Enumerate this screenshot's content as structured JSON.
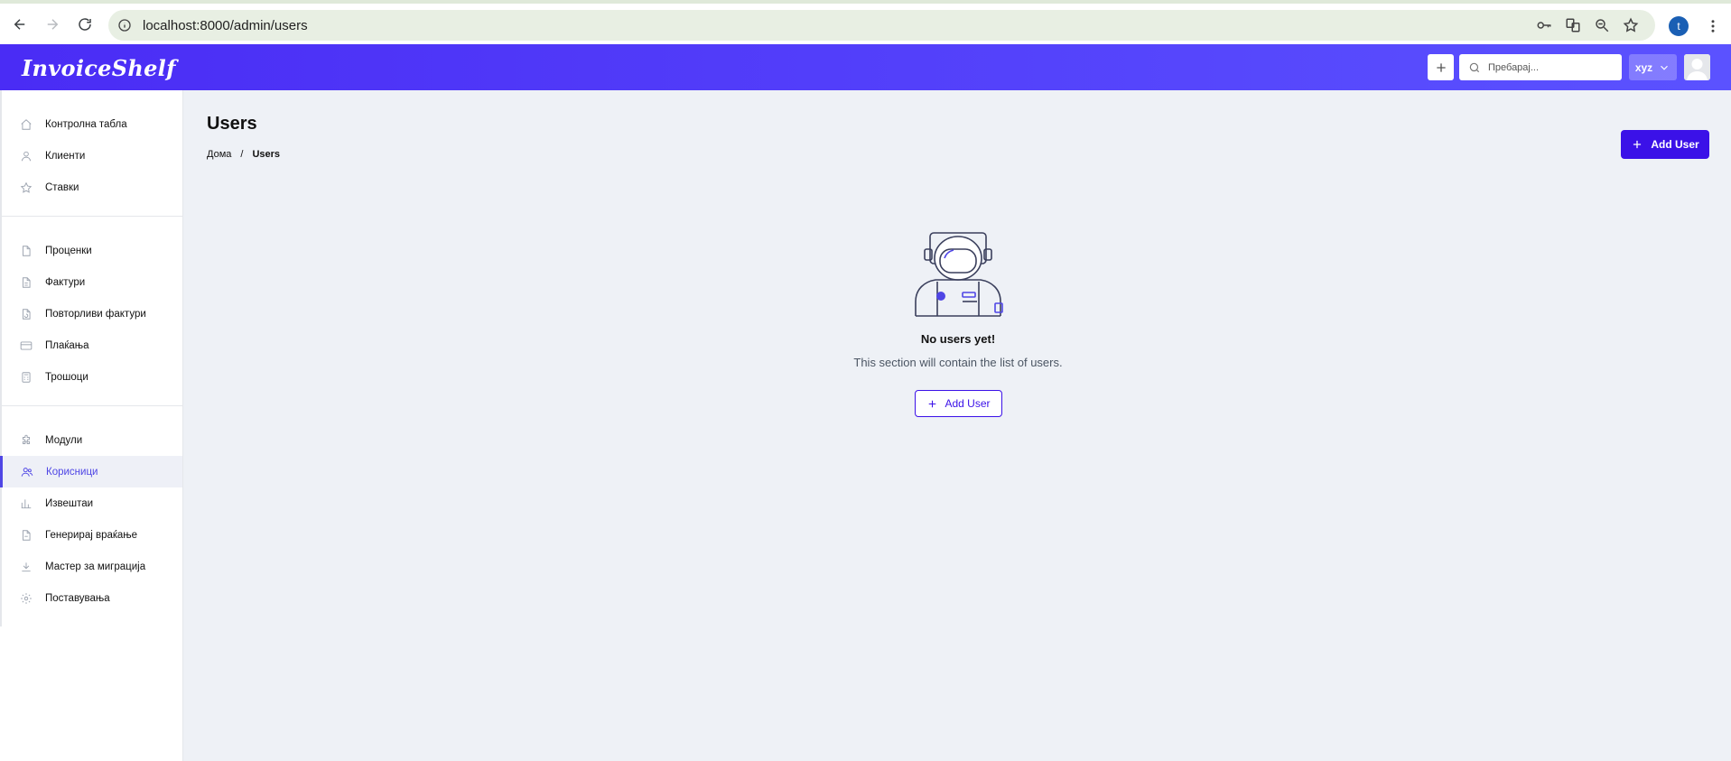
{
  "browser": {
    "url": "localhost:8000/admin/users",
    "profile_initial": "t"
  },
  "header": {
    "logo": "InvoiceShelf",
    "search_placeholder": "Пребарај...",
    "company": "xyz"
  },
  "sidebar": {
    "groups": [
      [
        {
          "label": "Контролна табла",
          "icon": "home-icon"
        },
        {
          "label": "Клиенти",
          "icon": "user-icon"
        },
        {
          "label": "Ставки",
          "icon": "star-icon"
        }
      ],
      [
        {
          "label": "Проценки",
          "icon": "document-icon"
        },
        {
          "label": "Фактури",
          "icon": "document-text-icon"
        },
        {
          "label": "Повторливи фактури",
          "icon": "document-repeat-icon"
        },
        {
          "label": "Плаќања",
          "icon": "credit-card-icon"
        },
        {
          "label": "Трошоци",
          "icon": "calculator-icon"
        }
      ],
      [
        {
          "label": "Модули",
          "icon": "puzzle-icon"
        },
        {
          "label": "Корисници",
          "icon": "users-icon",
          "active": true
        },
        {
          "label": "Извештаи",
          "icon": "chart-bar-icon"
        },
        {
          "label": "Генерирај враќање",
          "icon": "document-return-icon"
        },
        {
          "label": "Мастер за миграција",
          "icon": "download-icon"
        },
        {
          "label": "Поставувања",
          "icon": "cog-icon"
        }
      ]
    ]
  },
  "main": {
    "title": "Users",
    "breadcrumb": {
      "home": "Дома",
      "separator": "/",
      "current": "Users"
    },
    "add_button": "Add User",
    "empty": {
      "title": "No users yet!",
      "subtitle": "This section will contain the list of users.",
      "button": "Add User"
    }
  },
  "colors": {
    "primary": "#3b11e8",
    "header_gradient_start": "#4a2cf5",
    "header_gradient_end": "#5b52ff",
    "background": "#eef1f6"
  }
}
